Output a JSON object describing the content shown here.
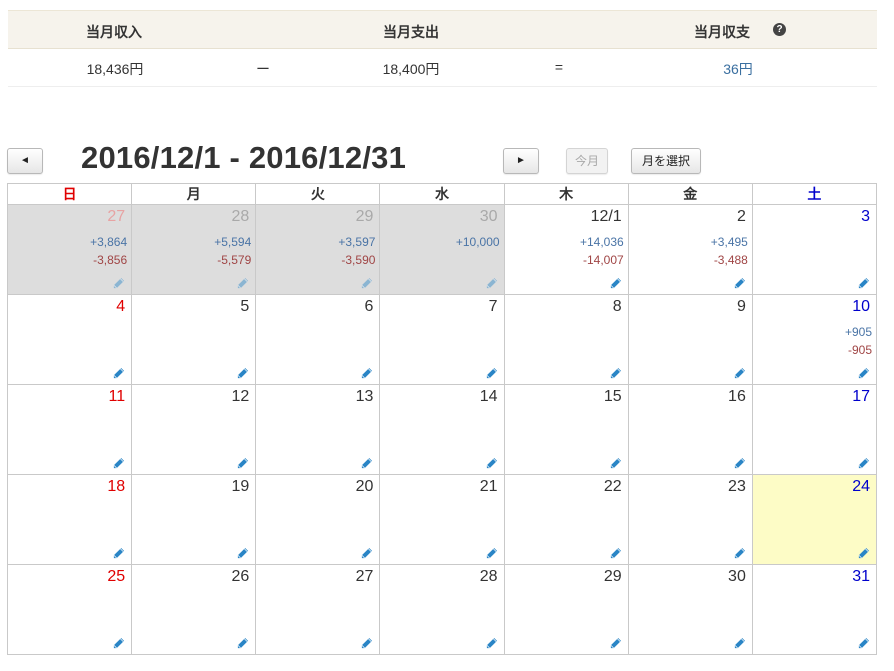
{
  "summary": {
    "income_label": "当月収入",
    "expense_label": "当月支出",
    "balance_label": "当月収支",
    "help_icon": "question-circle-icon",
    "income_value": "18,436円",
    "minus_sign": "ー",
    "expense_value": "18,400円",
    "equals_sign": "=",
    "balance_value": "36円"
  },
  "nav": {
    "prev_label": "◄",
    "period_title": "2016/12/1 - 2016/12/31",
    "next_label": "►",
    "today_label": "今月",
    "select_month_label": "月を選択"
  },
  "colors": {
    "sunday": "#e00000",
    "saturday": "#0000cc",
    "income": "#4a74a6",
    "expense": "#a04545",
    "other_month_bg": "#dddddd",
    "today_bg": "#fdfcc6",
    "header_bg": "#f6f3ec"
  },
  "calendar": {
    "weekdays": [
      "日",
      "月",
      "火",
      "水",
      "木",
      "金",
      "土"
    ],
    "edit_icon": "pencil-icon",
    "weeks": [
      [
        {
          "day": "27",
          "other": true,
          "income": "+3,864",
          "expense": "-3,856"
        },
        {
          "day": "28",
          "other": true,
          "income": "+5,594",
          "expense": "-5,579"
        },
        {
          "day": "29",
          "other": true,
          "income": "+3,597",
          "expense": "-3,590"
        },
        {
          "day": "30",
          "other": true,
          "income": "+10,000",
          "expense": ""
        },
        {
          "day": "12/1",
          "income": "+14,036",
          "expense": "-14,007"
        },
        {
          "day": "2",
          "income": "+3,495",
          "expense": "-3,488"
        },
        {
          "day": "3",
          "income": "",
          "expense": ""
        }
      ],
      [
        {
          "day": "4"
        },
        {
          "day": "5"
        },
        {
          "day": "6"
        },
        {
          "day": "7"
        },
        {
          "day": "8"
        },
        {
          "day": "9"
        },
        {
          "day": "10",
          "income": "+905",
          "expense": "-905"
        }
      ],
      [
        {
          "day": "11"
        },
        {
          "day": "12"
        },
        {
          "day": "13"
        },
        {
          "day": "14"
        },
        {
          "day": "15"
        },
        {
          "day": "16"
        },
        {
          "day": "17"
        }
      ],
      [
        {
          "day": "18"
        },
        {
          "day": "19"
        },
        {
          "day": "20"
        },
        {
          "day": "21"
        },
        {
          "day": "22"
        },
        {
          "day": "23"
        },
        {
          "day": "24",
          "today": true
        }
      ],
      [
        {
          "day": "25"
        },
        {
          "day": "26"
        },
        {
          "day": "27"
        },
        {
          "day": "28"
        },
        {
          "day": "29"
        },
        {
          "day": "30"
        },
        {
          "day": "31"
        }
      ]
    ]
  }
}
